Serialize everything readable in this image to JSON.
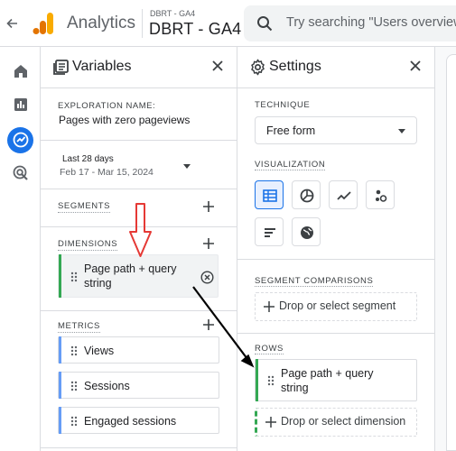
{
  "header": {
    "back_icon": "arrow-back-icon",
    "app_name": "Analytics",
    "account_small": "DBRT - GA4",
    "account_property": "DBRT - GA4",
    "search_placeholder": "Try searching \"Users overview\""
  },
  "rail": {
    "items": [
      "home-icon",
      "reports-icon",
      "explore-icon",
      "advertising-icon"
    ],
    "active": "explore-icon",
    "accent": "#1a73e8"
  },
  "variables": {
    "title": "Variables",
    "exploration_label": "EXPLORATION NAME:",
    "exploration_name": "Pages with zero pageviews",
    "date_label": "Last 28 days",
    "date_range": "Feb 17 - Mar 15, 2024",
    "segments_label": "SEGMENTS",
    "dimensions_label": "DIMENSIONS",
    "dimension_chip_line1": "Page path + query",
    "dimension_chip_line2": "string",
    "metrics_label": "METRICS",
    "metrics": [
      "Views",
      "Sessions",
      "Engaged sessions"
    ],
    "dimension_color": "#34a853",
    "metric_color": "#669df6"
  },
  "settings": {
    "title": "Settings",
    "technique_label": "TECHNIQUE",
    "technique_value": "Free form",
    "visualization_label": "VISUALIZATION",
    "visualizations": [
      "table-icon",
      "donut-chart-icon",
      "line-chart-icon",
      "scatter-chart-icon",
      "bar-chart-icon",
      "geo-map-icon"
    ],
    "segment_comparisons_label": "SEGMENT COMPARISONS",
    "segment_drop": "Drop or select segment",
    "rows_label": "ROWS",
    "row_chip_line1": "Page path + query",
    "row_chip_line2": "string",
    "dimension_drop": "Drop or select dimension"
  },
  "annotations": {
    "red_arrow_color": "#e53935",
    "black_arrow_color": "#000000"
  }
}
